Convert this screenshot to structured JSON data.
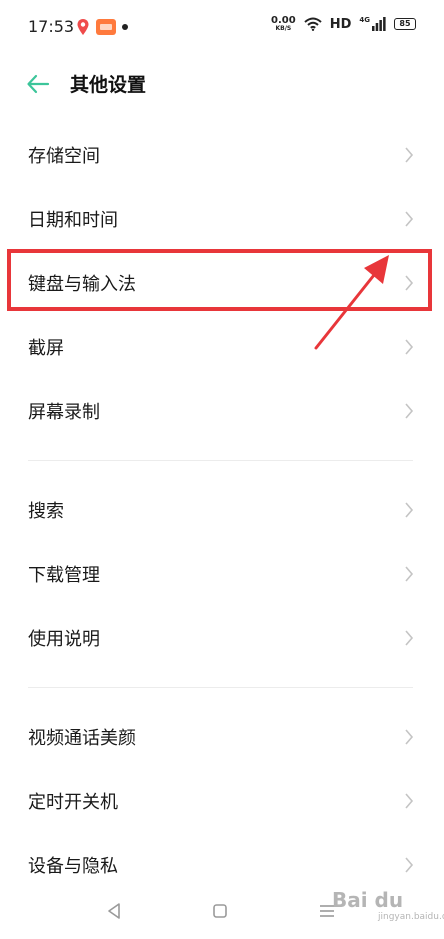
{
  "status_bar": {
    "time": "17:53",
    "net_speed_value": "0.00",
    "net_speed_unit": "KB/S",
    "hd": "HD",
    "signal_label": "4G",
    "battery": "85"
  },
  "header": {
    "title": "其他设置"
  },
  "menu": {
    "items": [
      {
        "label": "存储空间"
      },
      {
        "label": "日期和时间"
      },
      {
        "label": "键盘与输入法"
      },
      {
        "label": "截屏"
      },
      {
        "label": "屏幕录制"
      },
      {
        "label": "搜索"
      },
      {
        "label": "下载管理"
      },
      {
        "label": "使用说明"
      },
      {
        "label": "视频通话美颜"
      },
      {
        "label": "定时开关机"
      },
      {
        "label": "设备与隐私"
      }
    ]
  },
  "colors": {
    "accent_green": "#3cc59a",
    "highlight_red": "#e8363a"
  },
  "watermark": {
    "main": "Bai du",
    "sub": "jingyan.baidu.com"
  }
}
